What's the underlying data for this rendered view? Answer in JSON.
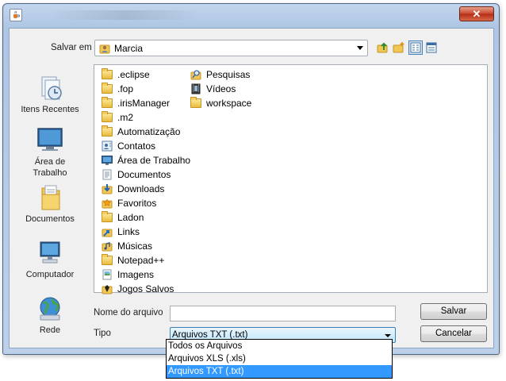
{
  "window": {
    "close_glyph": "✕",
    "java_icon": "java-cup-icon"
  },
  "toolbar": {
    "look_in_label": "Salvar em",
    "current_folder": "Marcia",
    "tools": [
      "up-folder-icon",
      "new-folder-icon",
      "list-view-icon",
      "details-view-icon"
    ]
  },
  "places": [
    {
      "label": "Itens Recentes",
      "icon": "recent-items-icon"
    },
    {
      "label": "Área de Trabalho",
      "icon": "desktop-icon"
    },
    {
      "label": "Documentos",
      "icon": "documents-icon"
    },
    {
      "label": "Computador",
      "icon": "computer-icon"
    },
    {
      "label": "Rede",
      "icon": "network-icon"
    }
  ],
  "files": {
    "col1": [
      {
        "name": ".eclipse",
        "icon": "folder"
      },
      {
        "name": ".fop",
        "icon": "folder"
      },
      {
        "name": ".irisManager",
        "icon": "folder"
      },
      {
        "name": ".m2",
        "icon": "folder"
      },
      {
        "name": "Automatização",
        "icon": "folder"
      },
      {
        "name": "Contatos",
        "icon": "contacts"
      },
      {
        "name": "Área de Trabalho",
        "icon": "desktop"
      },
      {
        "name": "Documentos",
        "icon": "documents"
      },
      {
        "name": "Downloads",
        "icon": "downloads"
      },
      {
        "name": "Favoritos",
        "icon": "favorites"
      },
      {
        "name": "Ladon",
        "icon": "folder"
      },
      {
        "name": "Links",
        "icon": "links"
      },
      {
        "name": "Músicas",
        "icon": "music"
      },
      {
        "name": "Notepad++",
        "icon": "folder"
      },
      {
        "name": "Imagens",
        "icon": "pictures"
      },
      {
        "name": "Jogos Salvos",
        "icon": "saved-games"
      }
    ],
    "col2": [
      {
        "name": "Pesquisas",
        "icon": "searches"
      },
      {
        "name": "Vídeos",
        "icon": "videos"
      },
      {
        "name": "workspace",
        "icon": "folder"
      }
    ]
  },
  "form": {
    "filename_label": "Nome do arquivo",
    "filename_value": "",
    "type_label": "Tipo",
    "type_selected": "Arquivos TXT (.txt)",
    "type_options": [
      "Todos os Arquivos",
      "Arquivos XLS (.xls)",
      "Arquivos TXT (.txt)"
    ],
    "save_label": "Salvar",
    "cancel_label": "Cancelar"
  }
}
